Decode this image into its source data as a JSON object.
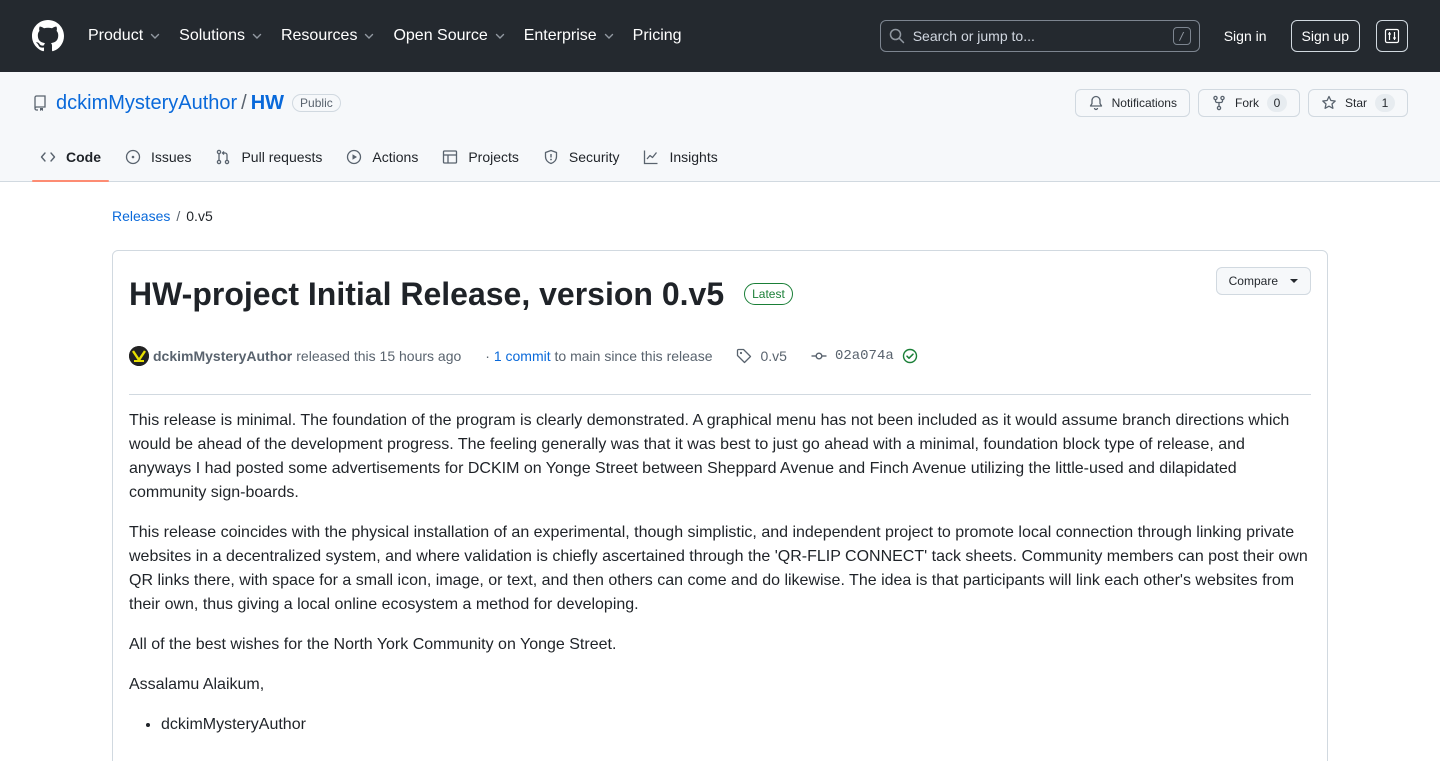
{
  "header": {
    "nav": [
      "Product",
      "Solutions",
      "Resources",
      "Open Source",
      "Enterprise",
      "Pricing"
    ],
    "nav_has_chevron": [
      true,
      true,
      true,
      true,
      true,
      false
    ],
    "search_placeholder": "Search or jump to...",
    "search_shortcut": "/",
    "sign_in": "Sign in",
    "sign_up": "Sign up"
  },
  "repo": {
    "owner": "dckimMysteryAuthor",
    "separator": "/",
    "name": "HW",
    "visibility": "Public",
    "notifications_label": "Notifications",
    "fork_label": "Fork",
    "fork_count": "0",
    "star_label": "Star",
    "star_count": "1",
    "tabs": [
      {
        "label": "Code",
        "icon": "code-icon",
        "active": true
      },
      {
        "label": "Issues",
        "icon": "issue-icon"
      },
      {
        "label": "Pull requests",
        "icon": "pull-request-icon"
      },
      {
        "label": "Actions",
        "icon": "play-icon"
      },
      {
        "label": "Projects",
        "icon": "table-icon"
      },
      {
        "label": "Security",
        "icon": "shield-icon"
      },
      {
        "label": "Insights",
        "icon": "graph-icon"
      }
    ]
  },
  "breadcrumb": {
    "releases": "Releases",
    "separator": "/",
    "current": "0.v5"
  },
  "release": {
    "title": "HW-project Initial Release, version 0.v5",
    "badge": "Latest",
    "compare": "Compare",
    "author": "dckimMysteryAuthor",
    "released_text": "released this 15 hours ago",
    "commits_prefix": "·",
    "commits_link": "1 commit",
    "commits_suffix": "to main since this release",
    "tag": "0.v5",
    "sha": "02a074a",
    "paragraphs": [
      "This release is minimal. The foundation of the program is clearly demonstrated. A graphical menu has not been included as it would assume branch directions which would be ahead of the development progress. The feeling generally was that it was best to just go ahead with a minimal, foundation block type of release, and anyways I had posted some advertisements for DCKIM on Yonge Street between Sheppard Avenue and Finch Avenue utilizing the little-used and dilapidated community sign-boards.",
      "This release coincides with the physical installation of an experimental, though simplistic, and independent project to promote local connection through linking private websites in a decentralized system, and where validation is chiefly ascertained through the 'QR-FLIP CONNECT' tack sheets. Community members can post their own QR links there, with space for a small icon, image, or text, and then others can come and do likewise. The idea is that participants will link each other's websites from their own, thus giving a local online ecosystem a method for developing.",
      "All of the best wishes for the North York Community on Yonge Street.",
      "Assalamu Alaikum,"
    ],
    "list": [
      "dckimMysteryAuthor"
    ]
  },
  "colors": {
    "header_bg": "#24292f",
    "link": "#0969da",
    "latest_green": "#1a7f37",
    "active_tab_underline": "#fd8c73"
  }
}
